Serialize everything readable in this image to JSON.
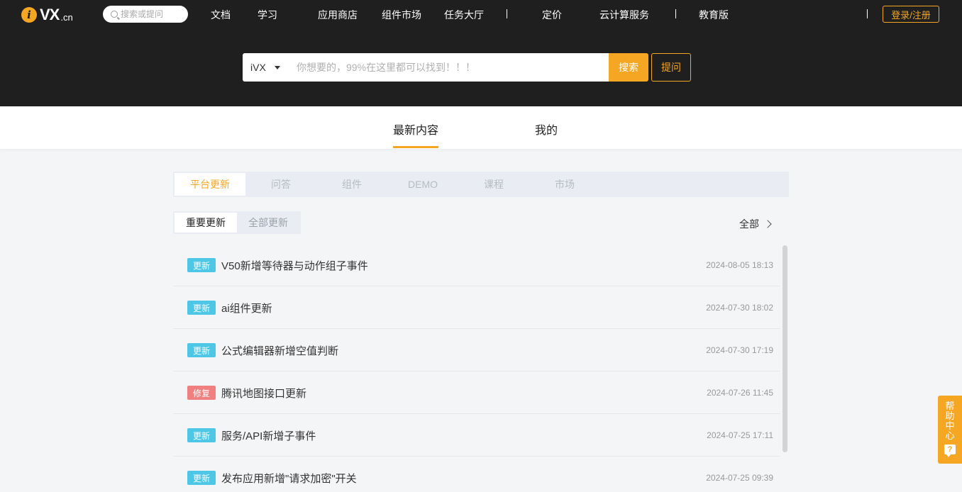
{
  "header": {
    "logo": {
      "mark": "i",
      "text": "VX",
      "suffix": ".cn"
    },
    "top_search_placeholder": "搜索或提问",
    "nav": [
      "文档",
      "学习",
      "应用商店",
      "组件市场",
      "任务大厅",
      "定价",
      "云计算服务",
      "教育版"
    ],
    "login_label": "登录/注册"
  },
  "search": {
    "selected_scope": "iVX",
    "placeholder": "你想要的，99%在这里都可以找到！！！",
    "search_label": "搜索",
    "ask_label": "提问"
  },
  "main_tabs": [
    "最新内容",
    "我的"
  ],
  "category_tabs": [
    "平台更新",
    "问答",
    "组件",
    "DEMO",
    "课程",
    "市场"
  ],
  "sub_tabs": [
    "重要更新",
    "全部更新"
  ],
  "all_label": "全部",
  "updates": [
    {
      "badge": "更新",
      "badge_color": "#4ec6e6",
      "title": "V50新增等待器与动作组子事件",
      "date": "2024-08-05 18:13"
    },
    {
      "badge": "更新",
      "badge_color": "#4ec6e6",
      "title": "ai组件更新",
      "date": "2024-07-30 18:02"
    },
    {
      "badge": "更新",
      "badge_color": "#4ec6e6",
      "title": "公式编辑器新增空值判断",
      "date": "2024-07-30 17:19"
    },
    {
      "badge": "修复",
      "badge_color": "#f08080",
      "title": "腾讯地图接口更新",
      "date": "2024-07-26 11:45"
    },
    {
      "badge": "更新",
      "badge_color": "#4ec6e6",
      "title": "服务/API新增子事件",
      "date": "2024-07-25 17:11"
    },
    {
      "badge": "更新",
      "badge_color": "#4ec6e6",
      "title": "发布应用新增\"请求加密\"开关",
      "date": "2024-07-25 09:39"
    }
  ],
  "help": {
    "label": "帮助中心",
    "icon_glyph": "?"
  },
  "colors": {
    "accent": "#f5a623",
    "header_bg": "#1f1f1f",
    "update_badge": "#4ec6e6",
    "fix_badge": "#f08080"
  }
}
